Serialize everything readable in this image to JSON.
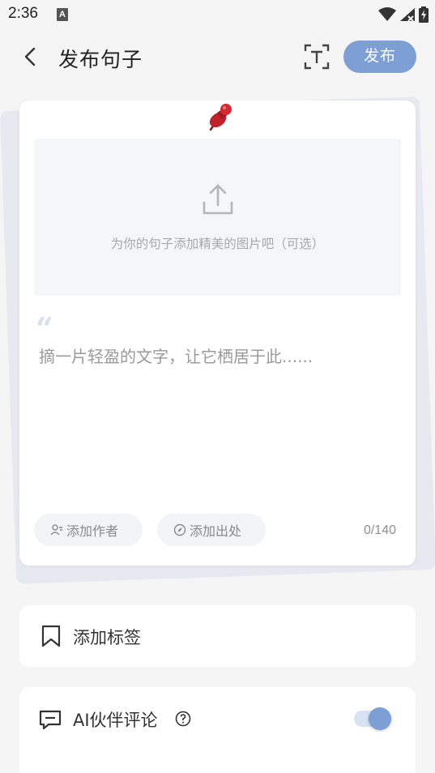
{
  "status_bar": {
    "time": "2:36",
    "notification_icon": "A"
  },
  "header": {
    "title": "发布句子",
    "publish_label": "发布"
  },
  "card": {
    "upload_hint": "为你的句子添加精美的图片吧（可选）",
    "quote_mark": "“",
    "text_placeholder": "摘一片轻盈的文字，让它栖居于此......",
    "add_author_label": "添加作者",
    "add_source_label": "添加出处",
    "char_count": "0/140"
  },
  "tag_row": {
    "label": "添加标签"
  },
  "ai_row": {
    "label": "AI伙伴评论",
    "toggle_on": true
  },
  "colors": {
    "accent": "#7d9fd6",
    "background": "#f5f5f6",
    "card": "#ffffff"
  }
}
